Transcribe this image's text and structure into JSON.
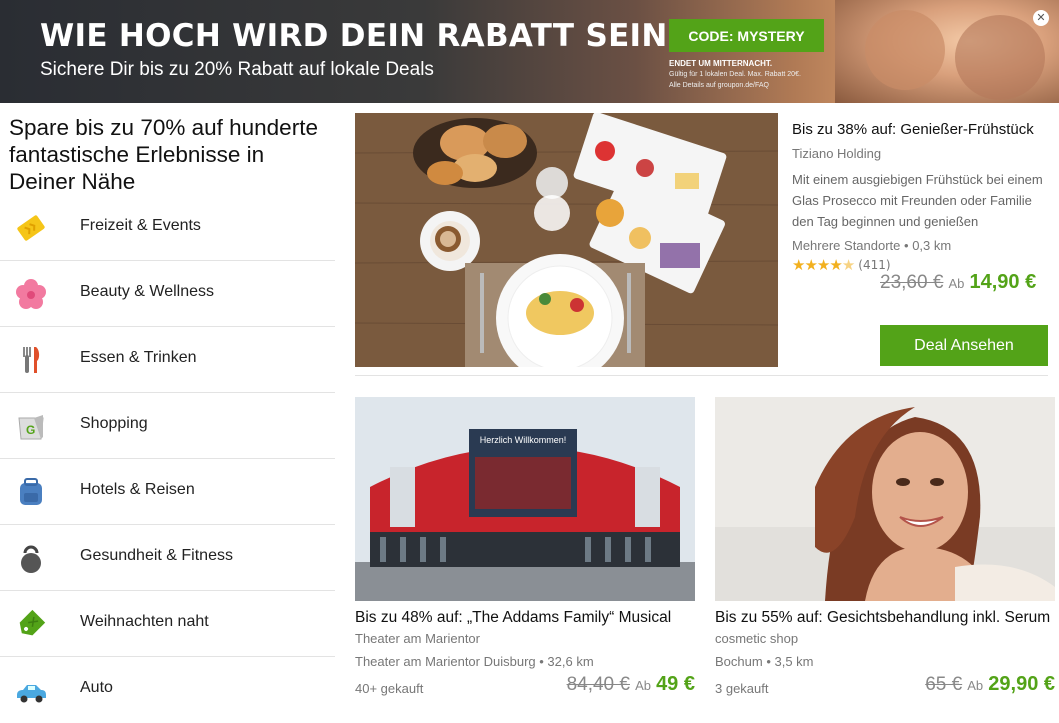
{
  "banner": {
    "title": "WIE HOCH WIRD DEIN RABATT SEIN?",
    "subtitle": "Sichere Dir bis zu 20% Rabatt auf lokale Deals",
    "code_label": "CODE: MYSTERY",
    "ends": "ENDET UM MITTERNACHT.",
    "fine1": "Gültig für 1 lokalen Deal. Max. Rabatt 20€.",
    "fine2": "Alle Details auf groupon.de/FAQ",
    "close": "✕"
  },
  "sidebar": {
    "title": "Spare bis zu 70% auf hunderte fantastische Erlebnisse in Deiner Nähe",
    "items": [
      {
        "label": "Freizeit & Events",
        "icon": "ticket-icon"
      },
      {
        "label": "Beauty & Wellness",
        "icon": "flower-icon"
      },
      {
        "label": "Essen & Trinken",
        "icon": "cutlery-icon"
      },
      {
        "label": "Shopping",
        "icon": "shopping-bag-icon"
      },
      {
        "label": "Hotels & Reisen",
        "icon": "backpack-icon"
      },
      {
        "label": "Gesundheit & Fitness",
        "icon": "kettlebell-icon"
      },
      {
        "label": "Weihnachten naht",
        "icon": "gift-tag-icon"
      },
      {
        "label": "Auto",
        "icon": "car-icon"
      }
    ]
  },
  "featured": {
    "title": "Bis zu 38% auf: Genießer-Frühstück",
    "merchant": "Tiziano Holding",
    "description": "Mit einem ausgiebigen Frühstück bei einem Glas Prosecco mit Freunden oder Familie den Tag beginnen und genießen",
    "location": "Mehrere Standorte",
    "distance": "• 0,3 km",
    "rating": 4.5,
    "rating_count": "(411)",
    "old_price": "23,60 €",
    "ab": "Ab",
    "new_price": "14,90 €",
    "button": "Deal Ansehen"
  },
  "cards": [
    {
      "title": "Bis zu 48% auf: „The Addams Family“ Musical",
      "merchant": "Theater am Marientor",
      "location": "Theater am Marientor Duisburg",
      "distance": "• 32,6 km",
      "bought": "40+ gekauft",
      "old_price": "84,40 €",
      "ab": "Ab",
      "new_price": "49 €",
      "sign_text": "Herzlich Willkommen!"
    },
    {
      "title": "Bis zu 55% auf: Gesichtsbehandlung inkl. Serum",
      "merchant": "cosmetic shop",
      "location": "Bochum",
      "distance": "• 3,5 km",
      "bought": "3 gekauft",
      "old_price": "65 €",
      "ab": "Ab",
      "new_price": "29,90 €"
    }
  ],
  "colors": {
    "accent": "#53a318",
    "star": "#f2b01e"
  }
}
